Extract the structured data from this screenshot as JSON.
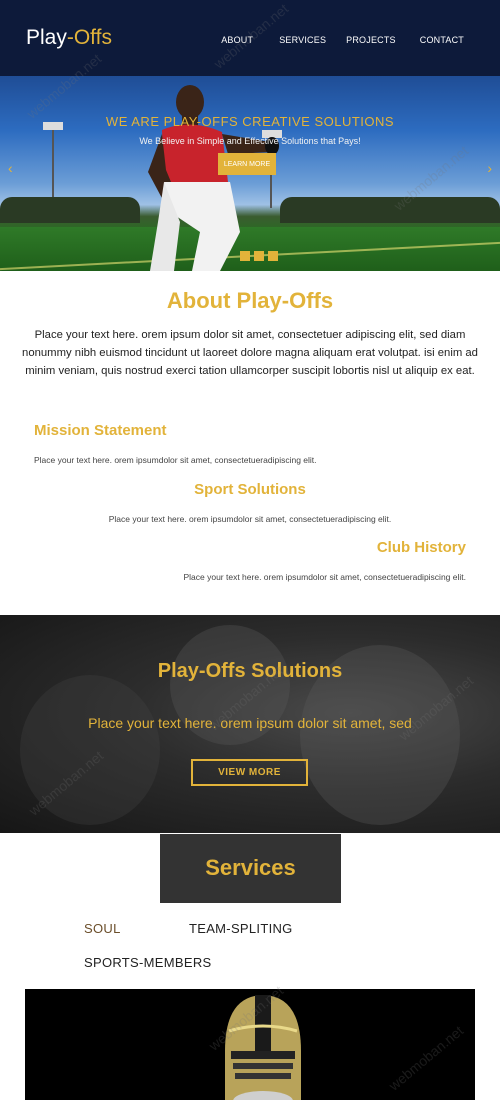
{
  "header": {
    "logo_left": "Play",
    "logo_accent": "-Offs",
    "nav": [
      "ABOUT",
      "SERVICES",
      "PROJECTS",
      "CONTACT"
    ]
  },
  "hero": {
    "title": "WE ARE PLAY-OFFS CREATIVE SOLUTIONS",
    "subtitle": "We Believe in Simple and Effective Solutions that Pays!",
    "button": "LEARN MORE",
    "prev_arrow": "‹",
    "next_arrow": "›",
    "active_slide": 1,
    "slide_count": 3
  },
  "about": {
    "title": "About Play-Offs",
    "text": "Place your text here. orem ipsum dolor sit amet, consectetuer adipiscing elit, sed diam nonummy nibh euismod tincidunt ut laoreet dolore magna aliquam erat volutpat. isi enim ad minim veniam, quis nostrud exerci tation ullamcorper suscipit lobortis nisl ut aliquip ex eat.",
    "features": [
      {
        "title": "Mission Statement",
        "text": "Place your text here. orem ipsumdolor sit amet, consectetueradipiscing elit."
      },
      {
        "title": "Sport Solutions",
        "text": "Place your text here. orem ipsumdolor sit amet, consectetueradipiscing elit."
      },
      {
        "title": "Club History",
        "text": "Place your text here. orem ipsumdolor sit amet, consectetueradipiscing elit."
      }
    ]
  },
  "solutions": {
    "title": "Play-Offs Solutions",
    "text": "Place your text here. orem ipsum dolor sit amet, sed",
    "button": "VIEW MORE"
  },
  "services": {
    "title": "Services",
    "tabs": [
      "SOUL",
      "TEAM-SPLITING",
      "SPORTS-MEMBERS"
    ],
    "active_tab": 0
  },
  "watermark": "webmoban.net",
  "colors": {
    "accent": "#e2b33a",
    "header_bg": "#0d1a3a",
    "dark_box": "#333333"
  }
}
